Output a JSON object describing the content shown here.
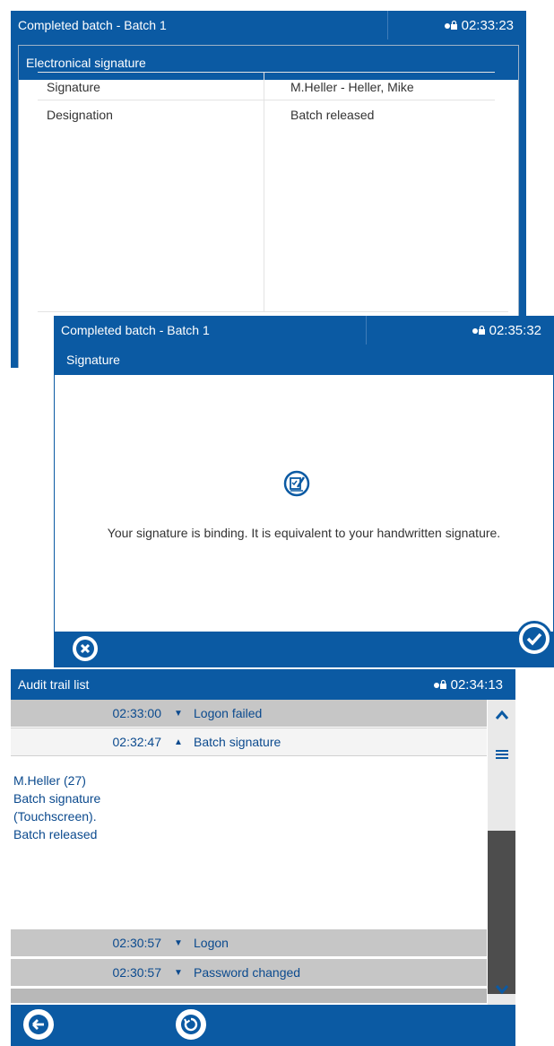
{
  "panel1": {
    "title": "Completed batch - Batch 1",
    "time": "02:33:23",
    "section_title": "Electronical signature",
    "rows": [
      {
        "label": "Signature",
        "value": "M.Heller - Heller, Mike"
      },
      {
        "label": "Designation",
        "value": "Batch released"
      }
    ]
  },
  "panel2": {
    "title": "Completed batch - Batch 1",
    "time": "02:35:32",
    "section_title": "Signature",
    "message": "Your signature is binding. It is equivalent to your handwritten signature."
  },
  "panel3": {
    "title": "Audit trail list",
    "time": "02:34:13",
    "entries": [
      {
        "time": "02:33:00",
        "icon": "shield-icon",
        "event": "Logon failed",
        "style": "grey"
      },
      {
        "time": "02:32:47",
        "icon": "warning-icon",
        "event": "Batch signature",
        "style": "white"
      },
      {
        "time": "02:30:57",
        "icon": "shield-icon",
        "event": "Logon",
        "style": "grey"
      },
      {
        "time": "02:30:57",
        "icon": "shield-icon",
        "event": "Password changed",
        "style": "grey"
      }
    ],
    "detail_lines": [
      "M.Heller (27)",
      "Batch signature",
      "(Touchscreen).",
      "Batch released"
    ]
  },
  "colors": {
    "accent": "#0b5aa3",
    "text_blue": "#0b4a8e",
    "row_grey": "#c6c6c6",
    "scroll_thumb": "#4d4d4d"
  }
}
